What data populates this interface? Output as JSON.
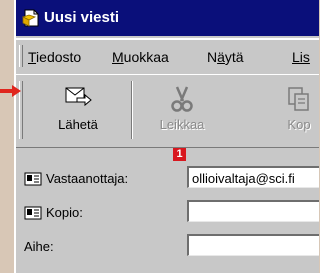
{
  "window": {
    "title": "Uusi viesti"
  },
  "menubar": {
    "items": [
      {
        "label": "Tiedosto",
        "accel": "T",
        "rest": "iedosto"
      },
      {
        "label": "Muokkaa",
        "accel": "M",
        "rest": "uokkaa"
      },
      {
        "label": "Näytä",
        "pre": "N",
        "accel": "ä",
        "rest": "ytä"
      },
      {
        "label": "Lisää",
        "accel": "Lis",
        "rest": ""
      }
    ]
  },
  "toolbar": {
    "send_label": "Lähetä",
    "cut_label": "Leikkaa",
    "copy_label": "Kop"
  },
  "fields": {
    "to": {
      "label": "Vastaanottaja:",
      "value": "ollioivaltaja@sci.fi"
    },
    "cc": {
      "label": "Kopio:",
      "value": ""
    },
    "subject": {
      "label": "Aihe:",
      "value": ""
    }
  },
  "annotation": {
    "badge": "1"
  },
  "colors": {
    "titlebar": "#0a0f7a",
    "chrome": "#c8c8c8",
    "badge": "#d8171e",
    "arrow": "#e0261d"
  }
}
